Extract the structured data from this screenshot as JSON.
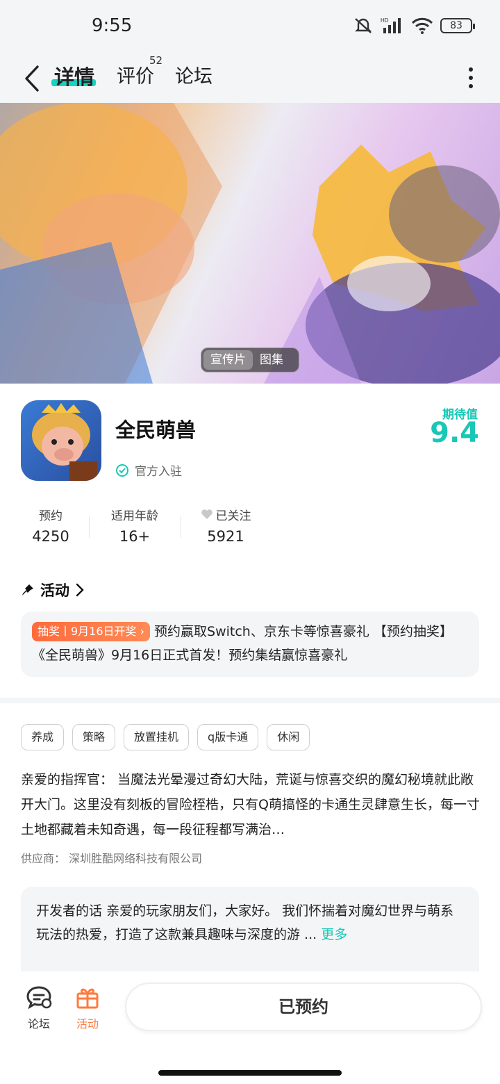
{
  "status_bar": {
    "time": "9:55",
    "battery": "83"
  },
  "nav": {
    "tabs": [
      {
        "label": "详情"
      },
      {
        "label": "评价"
      },
      {
        "label": "论坛"
      }
    ],
    "review_count": "52"
  },
  "hero": {
    "toggle": [
      "宣传片",
      "图集"
    ]
  },
  "app": {
    "name": "全民萌兽",
    "verified_label": "官方入驻",
    "expect_label": "期待值",
    "expect_score": "9.4"
  },
  "stats": [
    {
      "label": "预约",
      "value": "4250"
    },
    {
      "label": "适用年龄",
      "value": "16+"
    },
    {
      "label": "已关注",
      "value": "5921"
    }
  ],
  "activity": {
    "title": "活动",
    "badge": "抽奖丨9月16日开奖",
    "text": "预约赢取Switch、京东卡等惊喜豪礼 【预约抽奖】《全民萌兽》9月16日正式首发！预约集结赢惊喜豪礼"
  },
  "tags": [
    "养成",
    "策略",
    "放置挂机",
    "q版卡通",
    "休闲"
  ],
  "description": "亲爱的指挥官： 当魔法光晕漫过奇幻大陆，荒诞与惊喜交织的魔幻秘境就此敞开大门。这里没有刻板的冒险桎梏，只有Q萌搞怪的卡通生灵肆意生长，每一寸土地都藏着未知奇遇，每一段征程都写满治…",
  "supplier": "供应商：  深圳胜酷网络科技有限公司",
  "developer": {
    "title": "开发者的话",
    "text": "亲爱的玩家朋友们，大家好。 我们怀揣着对魔幻世界与萌系玩法的热爱，打造了这款兼具趣味与深度的游 ...",
    "more": "更多"
  },
  "bottom": {
    "forum_label": "论坛",
    "activity_label": "活动",
    "reserve_label": "已预约"
  },
  "colors": {
    "accent": "#19d3c2",
    "promo": "#ff6b3d",
    "activity_icon": "#ff7a3d"
  }
}
